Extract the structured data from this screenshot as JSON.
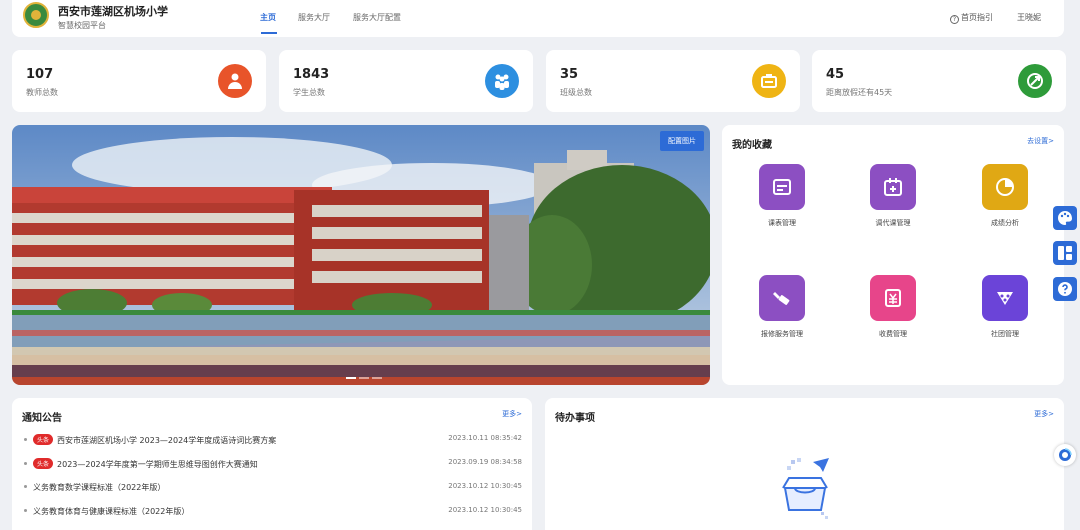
{
  "header": {
    "school_name": "西安市莲湖区机场小学",
    "platform": "智慧校园平台",
    "nav": [
      {
        "label": "主页",
        "active": true
      },
      {
        "label": "服务大厅",
        "active": false
      },
      {
        "label": "服务大厅配置",
        "active": false
      }
    ],
    "homepage_guide": "首页指引",
    "user_name": "王晓妮"
  },
  "stats": [
    {
      "value": "107",
      "label": "教师总数",
      "icon": "teacher-icon",
      "color": "#e8542a"
    },
    {
      "value": "1843",
      "label": "学生总数",
      "icon": "students-icon",
      "color": "#2d8fe0"
    },
    {
      "value": "35",
      "label": "班级总数",
      "icon": "class-icon",
      "color": "#efb414"
    },
    {
      "value": "45",
      "label": "距离放假还有45天",
      "icon": "vacation-icon",
      "color": "#2e9b3a"
    }
  ],
  "banner": {
    "config_button": "配置图片",
    "active_slide": 0,
    "slide_count": 3
  },
  "favorites": {
    "title": "我的收藏",
    "more": "去设置>",
    "items": [
      {
        "label": "课表管理",
        "icon": "schedule-icon",
        "color": "#8c4fc2"
      },
      {
        "label": "调代课管理",
        "icon": "substitute-calendar-icon",
        "color": "#8c4fc2"
      },
      {
        "label": "成绩分析",
        "icon": "pie-chart-icon",
        "color": "#e0a814"
      },
      {
        "label": "报修服务管理",
        "icon": "repair-icon",
        "color": "#8c4fc2"
      },
      {
        "label": "收费管理",
        "icon": "fee-icon",
        "color": "#e7458a"
      },
      {
        "label": "社团管理",
        "icon": "club-icon",
        "color": "#6b44d8"
      }
    ]
  },
  "notices": {
    "title": "通知公告",
    "more": "更多>",
    "badge": "头条",
    "items": [
      {
        "title": "西安市莲湖区机场小学 2023—2024学年度成语诗词比赛方案",
        "date": "2023.10.11 08:35:42",
        "headline": true
      },
      {
        "title": "2023—2024学年度第一学期师生思维导图创作大赛通知",
        "date": "2023.09.19 08:34:58",
        "headline": true
      },
      {
        "title": "义务教育数学课程标准（2022年版）",
        "date": "2023.10.12 10:30:45",
        "headline": false
      },
      {
        "title": "义务教育体育与健康课程标准（2022年版）",
        "date": "2023.10.12 10:30:45",
        "headline": false
      }
    ]
  },
  "todo": {
    "title": "待办事项",
    "more": "更多>"
  },
  "side_tools": [
    {
      "name": "theme-palette-icon"
    },
    {
      "name": "layout-icon"
    },
    {
      "name": "help-icon"
    }
  ],
  "colors": {
    "accent": "#2d6bd6",
    "badge": "#e02b2b"
  }
}
